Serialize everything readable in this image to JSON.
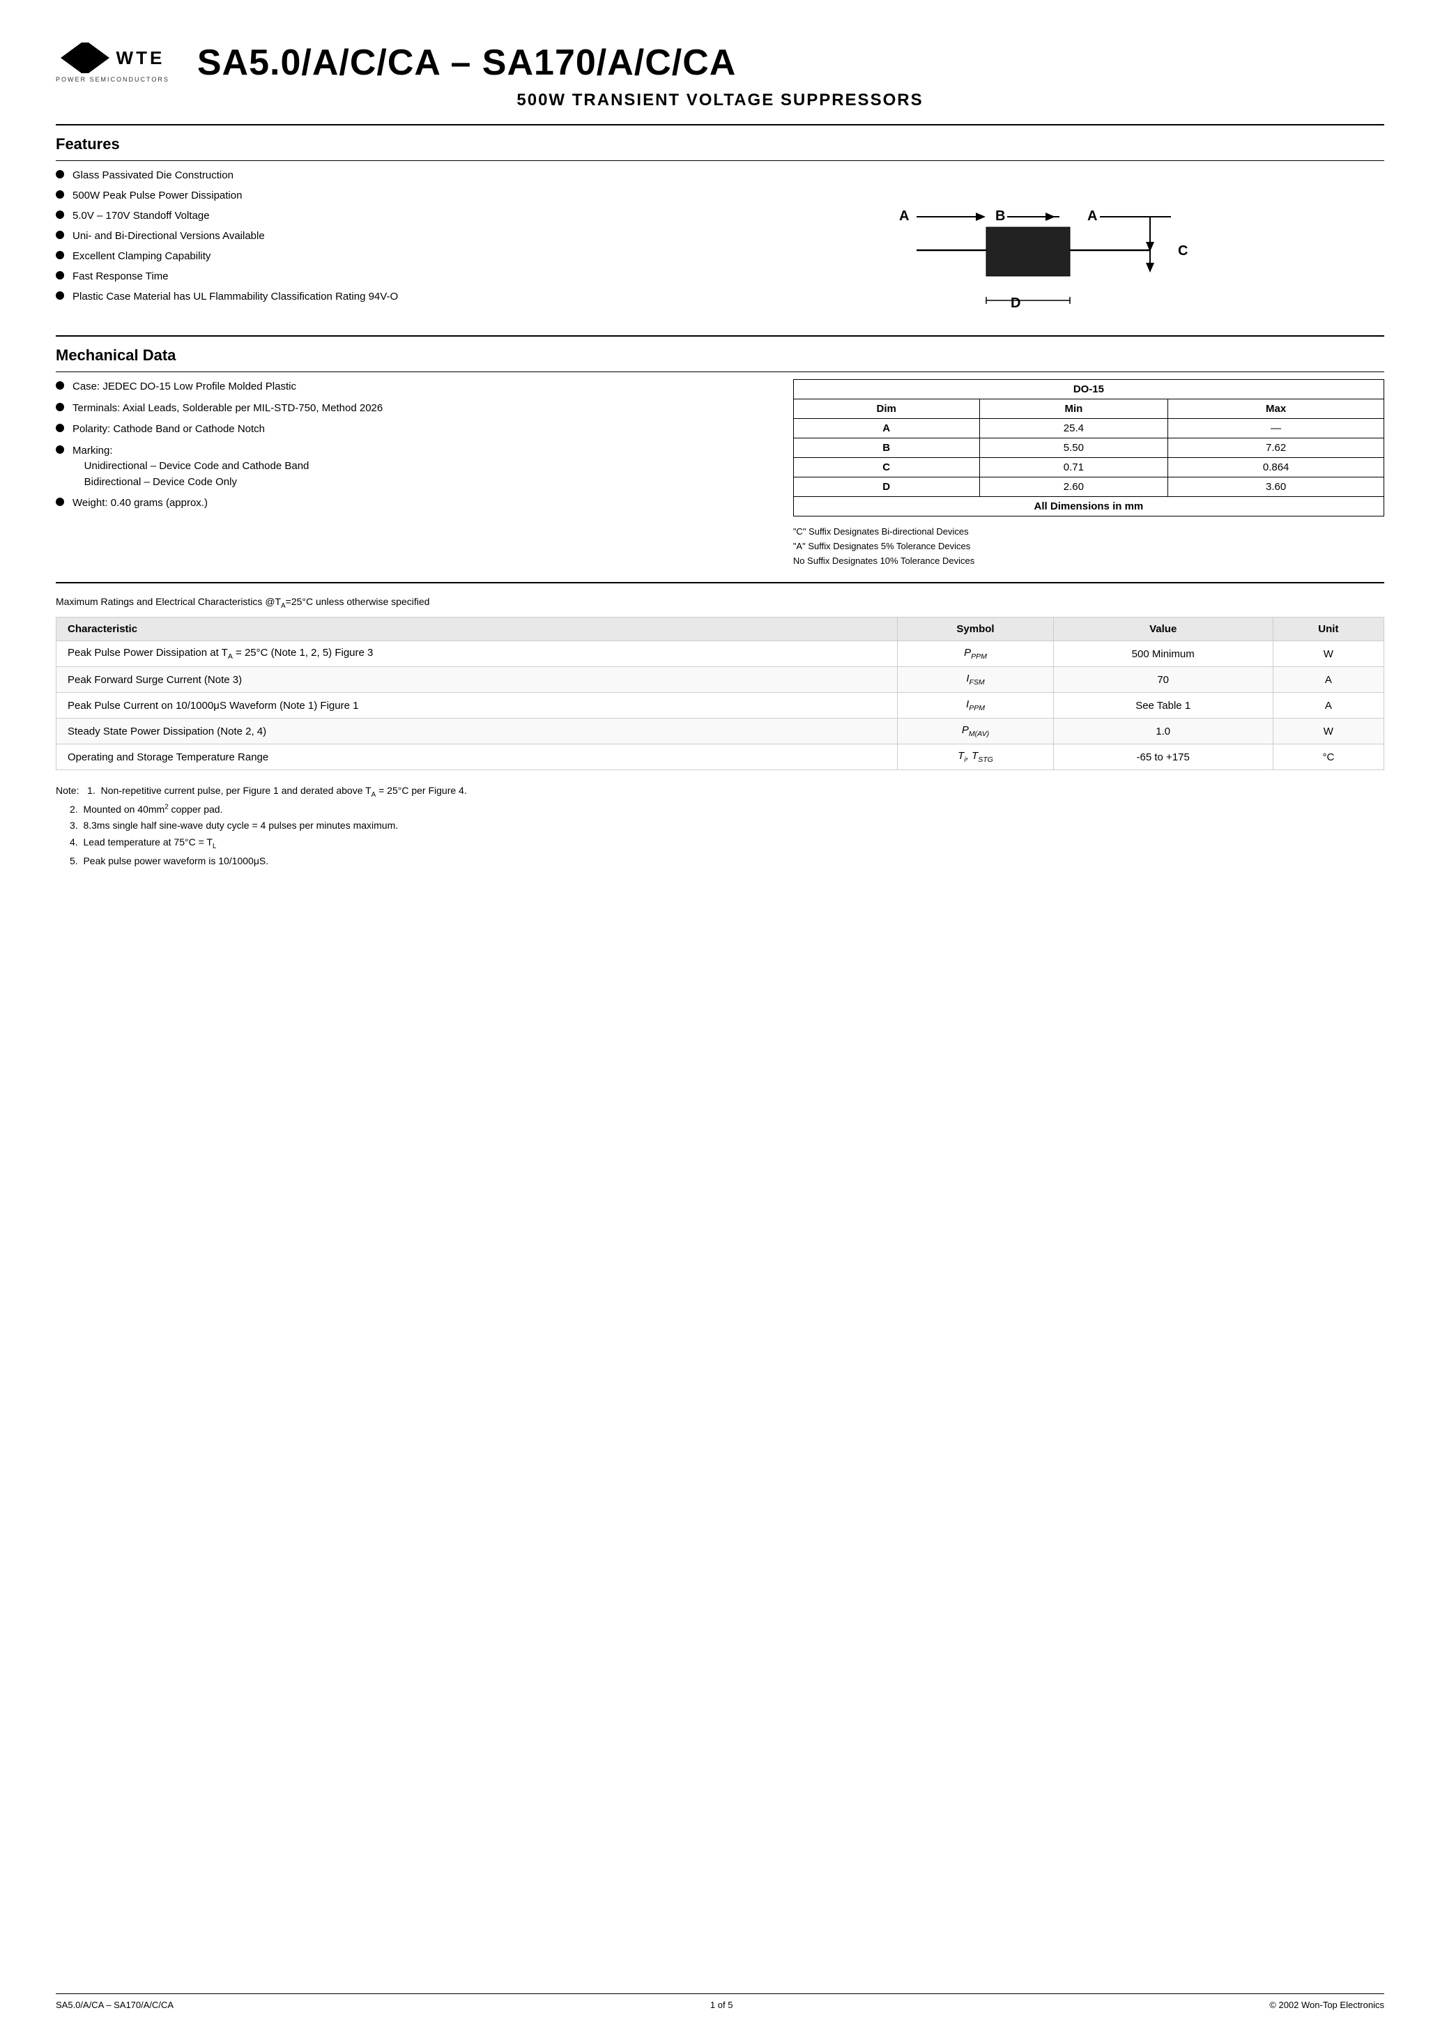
{
  "header": {
    "logo_text": "WTE",
    "logo_sub": "POWER SEMICONDUCTORS",
    "main_title": "SA5.0/A/C/CA – SA170/A/C/CA",
    "subtitle": "500W TRANSIENT VOLTAGE SUPPRESSORS"
  },
  "features": {
    "title": "Features",
    "items": [
      "Glass Passivated Die Construction",
      "500W Peak Pulse Power Dissipation",
      "5.0V – 170V Standoff Voltage",
      "Uni- and Bi-Directional Versions Available",
      "Excellent Clamping Capability",
      "Fast Response Time",
      "Plastic Case Material has UL Flammability Classification Rating 94V-O"
    ]
  },
  "diagram": {
    "labels": [
      "A",
      "B",
      "A",
      "C",
      "D"
    ]
  },
  "mechanical": {
    "title": "Mechanical Data",
    "items": [
      "Case: JEDEC DO-15 Low Profile Molded Plastic",
      "Terminals: Axial Leads, Solderable per MIL-STD-750, Method 2026",
      "Polarity: Cathode Band or Cathode Notch",
      "Marking:",
      "Unidirectional – Device Code and Cathode Band",
      "Bidirectional – Device Code Only",
      "Weight: 0.40 grams (approx.)"
    ]
  },
  "dim_table": {
    "title": "DO-15",
    "headers": [
      "Dim",
      "Min",
      "Max"
    ],
    "rows": [
      [
        "A",
        "25.4",
        "—"
      ],
      [
        "B",
        "5.50",
        "7.62"
      ],
      [
        "C",
        "0.71",
        "0.864"
      ],
      [
        "D",
        "2.60",
        "3.60"
      ]
    ],
    "footer": "All Dimensions in mm"
  },
  "suffix_notes": [
    "\"C\" Suffix Designates Bi-directional Devices",
    "\"A\" Suffix Designates 5% Tolerance Devices",
    "No Suffix Designates 10% Tolerance Devices"
  ],
  "max_ratings": {
    "title": "Maximum Ratings and Electrical Characteristics",
    "condition": "@TA=25°C unless otherwise specified",
    "headers": [
      "Characteristic",
      "Symbol",
      "Value",
      "Unit"
    ],
    "rows": [
      {
        "char": "Peak Pulse Power Dissipation at T",
        "char_sub": "A",
        "char_rest": " = 25°C (Note 1, 2, 5) Figure 3",
        "symbol": "PPPM",
        "value": "500 Minimum",
        "unit": "W"
      },
      {
        "char": "Peak Forward Surge Current (Note 3)",
        "char_sub": "",
        "char_rest": "",
        "symbol": "IFSM",
        "value": "70",
        "unit": "A"
      },
      {
        "char": "Peak Pulse Current on 10/1000μS Waveform (Note 1) Figure 1",
        "char_sub": "",
        "char_rest": "",
        "symbol": "IPPM",
        "value": "See Table 1",
        "unit": "A"
      },
      {
        "char": "Steady State Power Dissipation (Note 2, 4)",
        "char_sub": "",
        "char_rest": "",
        "symbol": "PM(AV)",
        "value": "1.0",
        "unit": "W"
      },
      {
        "char": "Operating and Storage Temperature Range",
        "char_sub": "",
        "char_rest": "",
        "symbol": "Ti, TSTG",
        "value": "-65 to +175",
        "unit": "°C"
      }
    ]
  },
  "notes": {
    "intro": "Note:",
    "items": [
      "1.  Non-repetitive current pulse, per Figure 1 and derated above T",
      "2.  Mounted on 40mm² copper pad.",
      "3.  8.3ms single half sine-wave duty cycle = 4 pulses per minutes maximum.",
      "4.  Lead temperature at 75°C = T",
      "5.  Peak pulse power waveform is 10/1000μS."
    ]
  },
  "footer": {
    "left": "SA5.0/A/CA – SA170/A/C/CA",
    "center": "1 of 5",
    "right": "© 2002 Won-Top Electronics"
  }
}
